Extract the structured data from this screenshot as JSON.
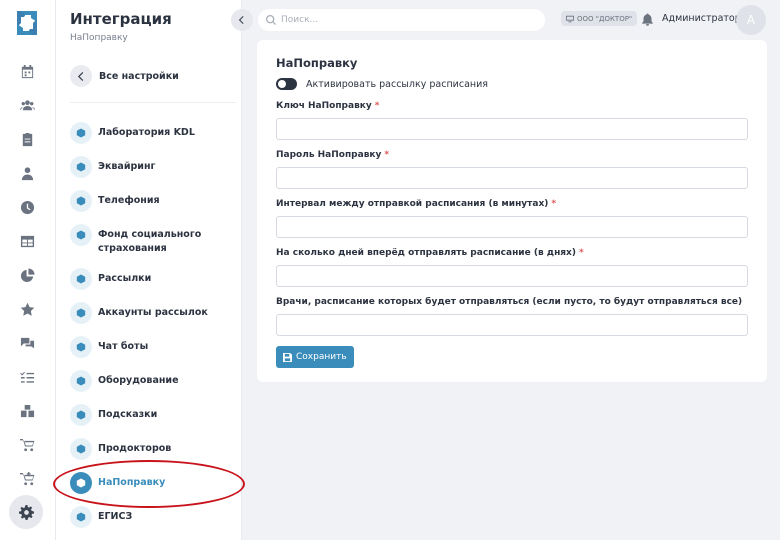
{
  "panel": {
    "title": "Интеграция",
    "subtitle": "НаПоправку",
    "back_label": "Все настройки",
    "items": [
      {
        "label": "Лаборатория KDL",
        "icon": "cube-icon"
      },
      {
        "label": "Эквайринг",
        "icon": "cube-icon"
      },
      {
        "label": "Телефония",
        "icon": "cube-icon"
      },
      {
        "label": "Фонд социального страхования",
        "icon": "cube-icon"
      },
      {
        "label": "Рассылки",
        "icon": "cube-icon"
      },
      {
        "label": "Аккаунты рассылок",
        "icon": "cube-icon"
      },
      {
        "label": "Чат боты",
        "icon": "cube-icon"
      },
      {
        "label": "Оборудование",
        "icon": "cube-icon"
      },
      {
        "label": "Подсказки",
        "icon": "cube-icon"
      },
      {
        "label": "Продокторов",
        "icon": "cube-icon"
      },
      {
        "label": "НаПоправку",
        "icon": "cube-icon",
        "active": true
      },
      {
        "label": "ЕГИСЗ",
        "icon": "cube-icon"
      }
    ]
  },
  "rail": {
    "icons": [
      "calendar-icon",
      "users-icon",
      "clipboard-icon",
      "doctor-icon",
      "clock-icon",
      "table-icon",
      "pie-chart-icon",
      "star-icon",
      "chat-icon",
      "checklist-icon",
      "boxes-icon",
      "cart-icon",
      "cart-plus-icon",
      "gear-icon"
    ],
    "active_icon": "gear-icon"
  },
  "topbar": {
    "search_placeholder": "Поиск...",
    "org": "ООО \"ДОКТОР\"",
    "user": "Администратор",
    "avatar_letter": "А"
  },
  "form": {
    "title": "НаПоправку",
    "toggle_label": "Активировать рассылку расписания",
    "toggle_on": false,
    "fields": [
      {
        "label": "Ключ НаПоправку",
        "required": "*",
        "value": ""
      },
      {
        "label": "Пароль НаПоправку",
        "required": "*",
        "value": ""
      },
      {
        "label": "Интервал между отправкой расписания (в минутах)",
        "required": "*",
        "value": ""
      },
      {
        "label": "На сколько дней вперёд отправлять расписание (в днях)",
        "required": "*",
        "value": ""
      },
      {
        "label": "Врачи, расписание которых будет отправляться (если пусто, то будут отправляться все)",
        "value": ""
      }
    ],
    "save_label": "Сохранить"
  },
  "colors": {
    "accent": "#3a8dbb",
    "required": "#e05757",
    "annotation_ring": "#c8131b"
  }
}
